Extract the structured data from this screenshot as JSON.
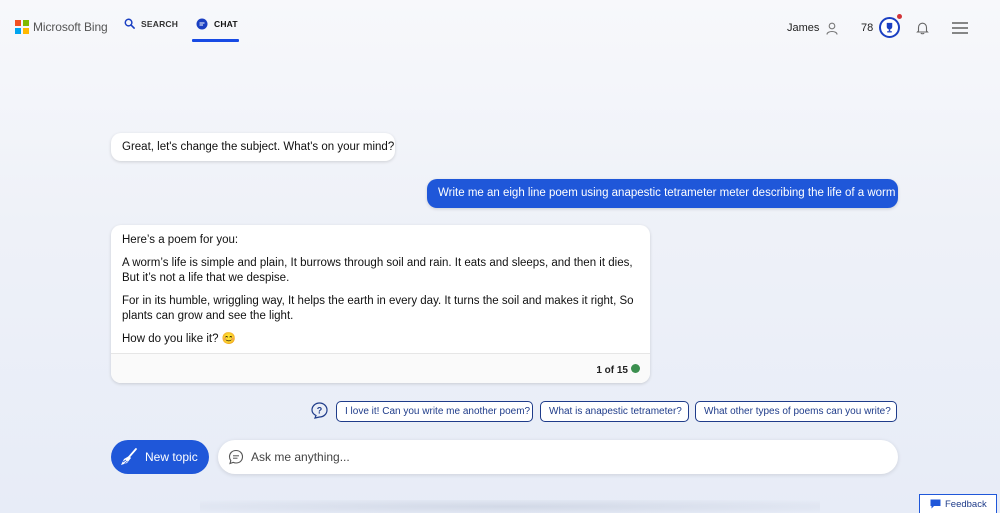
{
  "header": {
    "brand": "Microsoft Bing",
    "logo_colors": [
      "#f25022",
      "#7fba00",
      "#00a4ef",
      "#ffb900"
    ],
    "tabs": [
      {
        "label": "SEARCH",
        "icon": "search-icon"
      },
      {
        "label": "CHAT",
        "icon": "chat-icon",
        "active": true
      }
    ],
    "user_name": "James",
    "points": "78",
    "accent_color": "#174ae4"
  },
  "conversation": {
    "bot_message_1": "Great, let's change the subject. What's on your mind?",
    "user_message": "Write me an eigh line poem using anapestic tetrameter meter describing the life of a worm",
    "bot_message_2": {
      "intro": "Here’s a poem for you:",
      "stanza_1": "A worm’s life is simple and plain, It burrows through soil and rain. It eats and sleeps, and then it dies, But it’s not a life that we despise.",
      "stanza_2": "For in its humble, wriggling way, It helps the earth in every day. It turns the soil and makes it right, So plants can grow and see the light.",
      "closing": "How do you like it? 😊",
      "page_count": "1 of 15"
    }
  },
  "suggestions": [
    "I love it! Can you write me another poem?",
    "What is anapestic tetrameter?",
    "What other types of poems can you write?"
  ],
  "composer": {
    "new_topic_label": "New topic",
    "input_placeholder": "Ask me anything..."
  },
  "feedback_label": "Feedback"
}
